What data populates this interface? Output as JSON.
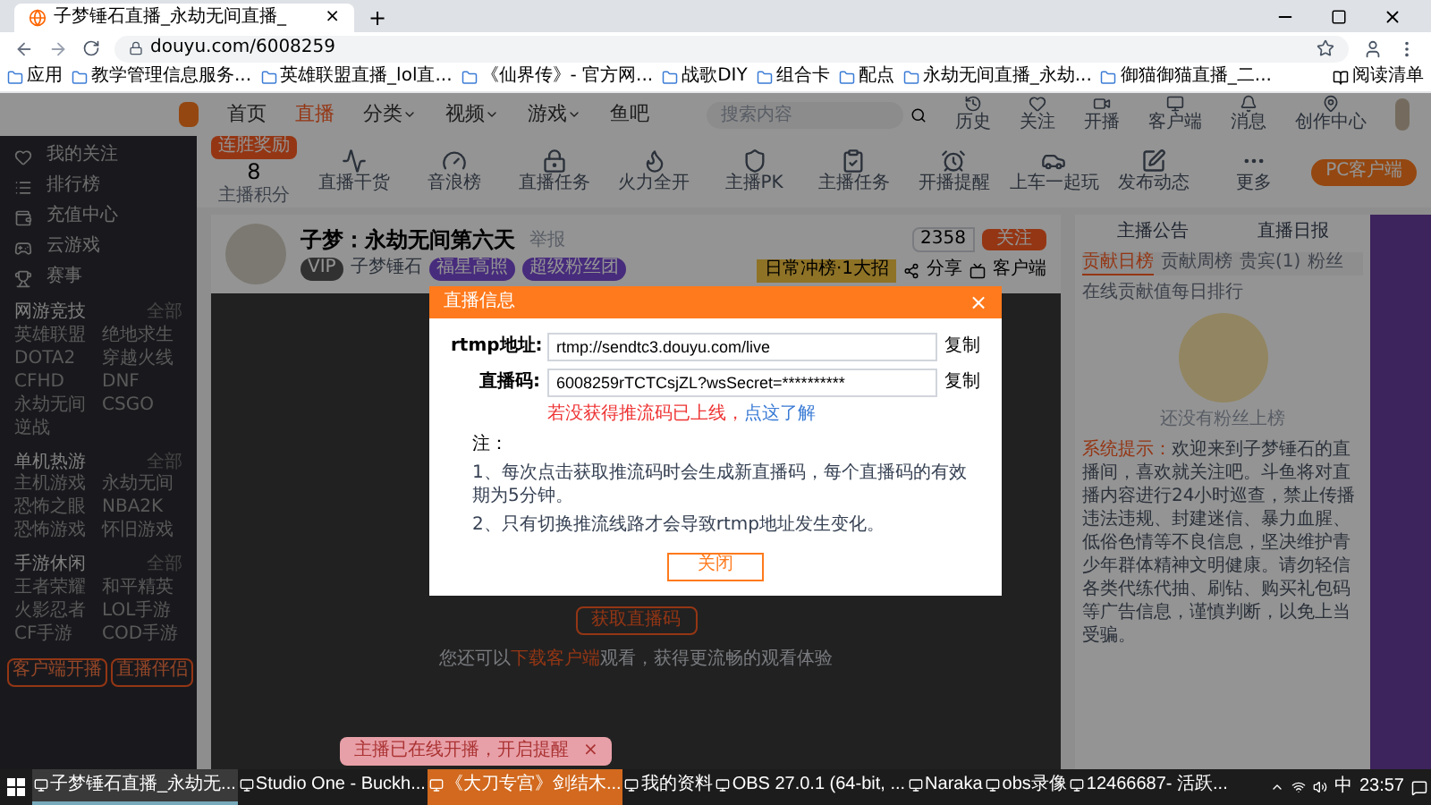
{
  "browser": {
    "tab": {
      "title": "子梦锤石直播_永劫无间直播_",
      "close": "×"
    },
    "new_tab": "+",
    "url": "douyu.com/6008259",
    "bookmarks": [
      "应用",
      "教学管理信息服务...",
      "英雄联盟直播_lol直...",
      "《仙界传》- 官方网...",
      "战歌DIY",
      "组合卡",
      "配点",
      "永劫无间直播_永劫...",
      "御猫御猫直播_二..."
    ],
    "reading_list": "阅读清单"
  },
  "site_header": {
    "nav": [
      {
        "label": "首页",
        "selected": false,
        "dropdown": false
      },
      {
        "label": "直播",
        "selected": true,
        "dropdown": false
      },
      {
        "label": "分类",
        "selected": false,
        "dropdown": true
      },
      {
        "label": "视频",
        "selected": false,
        "dropdown": true
      },
      {
        "label": "游戏",
        "selected": false,
        "dropdown": true
      },
      {
        "label": "鱼吧",
        "selected": false,
        "dropdown": false
      }
    ],
    "search": {
      "placeholder": "搜索内容"
    },
    "user_icons": [
      "历史",
      "关注",
      "开播",
      "客户端",
      "消息",
      "创作中心"
    ]
  },
  "sidebar": {
    "nav": [
      "我的关注",
      "排行榜",
      "充值中心",
      "云游戏",
      "赛事"
    ],
    "sections": [
      {
        "title": "网游竞技",
        "more": "全部",
        "items": [
          "英雄联盟",
          "绝地求生",
          "DOTA2",
          "穿越火线",
          "CFHD",
          "DNF",
          "永劫无间",
          "CSGO",
          "逆战"
        ]
      },
      {
        "title": "单机热游",
        "more": "全部",
        "items": [
          "主机游戏",
          "永劫无间",
          "恐怖之眼",
          "NBA2K",
          "恐怖游戏",
          "怀旧游戏"
        ]
      },
      {
        "title": "手游休闲",
        "more": "全部",
        "items": [
          "王者荣耀",
          "和平精英",
          "火影忍者",
          "LOL手游",
          "CF手游",
          "COD手游"
        ]
      }
    ],
    "buttons": [
      "客户端开播",
      "直播伴侣"
    ]
  },
  "toolbar": {
    "score": {
      "badge": "连胜奖励",
      "value": "8",
      "label": "主播积分"
    },
    "items": [
      "直播干货",
      "音浪榜",
      "直播任务",
      "火力全开",
      "主播PK",
      "主播任务",
      "开播提醒",
      "上车一起玩",
      "发布动态",
      "更多"
    ],
    "client_button": "PC客户端"
  },
  "room": {
    "title": "子梦：永劫无间第六天",
    "report": "举报",
    "streamer": "子梦锤石",
    "level_badge": "VIP",
    "tags": [
      "福星高照",
      "超级粉丝团"
    ],
    "follower_count": "2358",
    "follow": "关注",
    "rank_badge": "日常冲榜·1大招",
    "share": "分享",
    "client": "客户端"
  },
  "player": {
    "button": "获取直播码",
    "hint_before": "您还可以",
    "hint_link": "下载客户端",
    "hint_after": "观看，获得更流畅的观看体验"
  },
  "right_panel": {
    "top_tabs": [
      "主播公告",
      "直播日报"
    ],
    "rank_tabs": [
      {
        "label": "贡献日榜",
        "selected": true
      },
      {
        "label": "贡献周榜",
        "selected": false
      },
      {
        "label": "贵宾(1)",
        "selected": false
      },
      {
        "label": "粉丝",
        "selected": false
      }
    ],
    "rank_note": "在线贡献值每日排行",
    "empty": "还没有粉丝上榜",
    "notice_label": "系统提示：",
    "notice": "欢迎来到子梦锤石的直播间，喜欢就关注吧。斗鱼将对直播内容进行24小时巡查，禁止传播违法违规、封建迷信、暴力血腥、低俗色情等不良信息，坚决维护青少年群体精神文明健康。请勿轻信各类代练代抽、刷钻、购买礼包码等广告信息，谨慎判断，以免上当受骗。"
  },
  "modal": {
    "title": "直播信息",
    "close": "×",
    "fields": [
      {
        "label": "rtmp地址:",
        "value": "rtmp://sendtc3.douyu.com/live",
        "copy": "复制"
      },
      {
        "label": "直播码:",
        "value": "6008259rTCTCsjZL?wsSecret=**********",
        "copy": "复制"
      }
    ],
    "warning": "若没获得推流码已上线，",
    "warning_link": "点这了解",
    "note_title": "注：",
    "notes": [
      "1、每次点击获取推流码时会生成新直播码，每个直播码的有效期为5分钟。",
      "2、只有切换推流线路才会导致rtmp地址发生变化。"
    ],
    "button": "关闭"
  },
  "toast": {
    "text": "主播已在线开播，开启提醒",
    "close": "×"
  },
  "taskbar": {
    "items": [
      {
        "label": "子梦锤石直播_永劫无...",
        "selected": true,
        "highlighted": false
      },
      {
        "label": "Studio One - Buckh...",
        "selected": false,
        "highlighted": false
      },
      {
        "label": "《大刀专宫》剑结木...",
        "selected": false,
        "highlighted": true
      },
      {
        "label": "我的资料",
        "selected": false,
        "highlighted": false
      },
      {
        "label": "OBS 27.0.1 (64-bit, ...",
        "selected": false,
        "highlighted": false
      },
      {
        "label": "Naraka",
        "selected": false,
        "highlighted": false
      },
      {
        "label": "obs录像",
        "selected": false,
        "highlighted": false
      },
      {
        "label": "12466687- 活跃...",
        "selected": false,
        "highlighted": false
      }
    ],
    "ime": "中",
    "time": "23:57"
  }
}
